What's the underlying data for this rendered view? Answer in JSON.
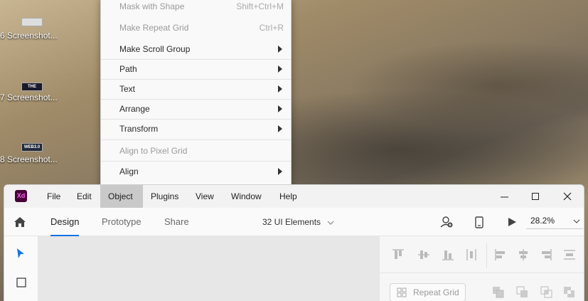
{
  "desktop": {
    "icons": [
      {
        "label": "6  Screenshot...",
        "thumb": ""
      },
      {
        "label": "7  Screenshot...",
        "thumb": "THE SKETCH"
      },
      {
        "label": "8  Screenshot...",
        "thumb": "WEB3.0"
      }
    ]
  },
  "menu": {
    "items": [
      {
        "label": "Mask with Shape",
        "shortcut": "Shift+Ctrl+M"
      },
      {
        "label": "Make Repeat Grid",
        "shortcut": "Ctrl+R"
      },
      {
        "label": "Make Scroll Group"
      },
      {
        "label": "Path"
      },
      {
        "label": "Text"
      },
      {
        "label": "Arrange"
      },
      {
        "label": "Transform"
      },
      {
        "label": "Align to Pixel Grid"
      },
      {
        "label": "Align"
      }
    ]
  },
  "app": {
    "logo": "Xd",
    "menubar": [
      "File",
      "Edit",
      "Object",
      "Plugins",
      "View",
      "Window",
      "Help"
    ],
    "tabs": [
      "Design",
      "Prototype",
      "Share"
    ],
    "document_title": "32 UI Elements",
    "zoom": "28.2%",
    "repeat_grid_label": "Repeat Grid"
  },
  "colors": {
    "accent": "#1473e6",
    "logo_bg": "#470137",
    "logo_fg": "#ff61f6",
    "select_arrow": "#1473e6"
  }
}
